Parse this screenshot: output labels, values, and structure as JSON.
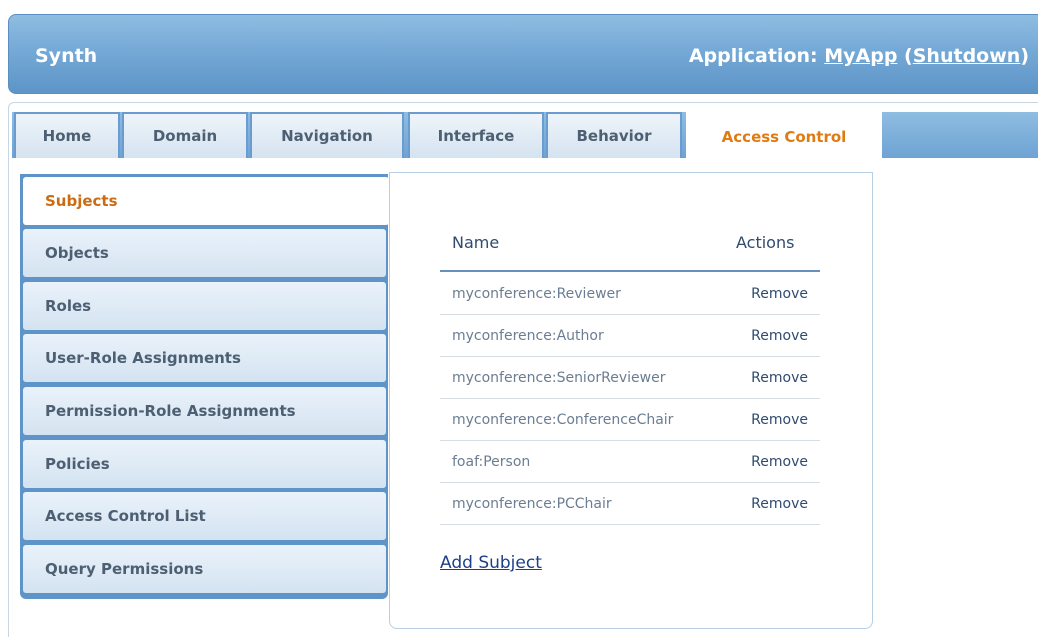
{
  "header": {
    "brand": "Synth",
    "app_prefix": "Application: ",
    "app_name": "MyApp",
    "paren_open": " (",
    "shutdown": "Shutdown",
    "paren_close": ")"
  },
  "tabs": [
    {
      "label": "Home"
    },
    {
      "label": "Domain"
    },
    {
      "label": "Navigation"
    },
    {
      "label": "Interface"
    },
    {
      "label": "Behavior"
    },
    {
      "label": "Access Control",
      "active": true
    }
  ],
  "menu": [
    {
      "label": "Subjects",
      "active": true
    },
    {
      "label": "Objects"
    },
    {
      "label": "Roles"
    },
    {
      "label": "User-Role Assignments"
    },
    {
      "label": "Permission-Role Assignments"
    },
    {
      "label": "Policies"
    },
    {
      "label": "Access Control List"
    },
    {
      "label": "Query Permissions"
    }
  ],
  "table": {
    "col_name": "Name",
    "col_actions": "Actions",
    "rows": [
      {
        "name": "myconference:Reviewer",
        "action": "Remove"
      },
      {
        "name": "myconference:Author",
        "action": "Remove"
      },
      {
        "name": "myconference:SeniorReviewer",
        "action": "Remove"
      },
      {
        "name": "myconference:ConferenceChair",
        "action": "Remove"
      },
      {
        "name": "foaf:Person",
        "action": "Remove"
      },
      {
        "name": "myconference:PCChair",
        "action": "Remove"
      }
    ]
  },
  "add_subject": "Add Subject",
  "colors": {
    "accent": "#e07a12",
    "header_blue": "#75a9d6",
    "link": "#1d3f8a"
  }
}
